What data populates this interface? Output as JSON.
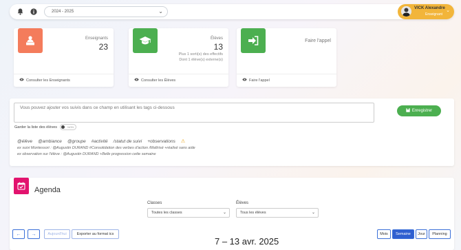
{
  "topbar": {
    "bell_icon": "bell-icon",
    "info_icon": "info-icon",
    "year": "2024 - 2025",
    "user_name": "VICK Alexandre",
    "user_role": "Enseignant"
  },
  "cards": {
    "teachers": {
      "title": "Enseignants",
      "count": "23",
      "link": "Consulter les Enseignants",
      "color": "#f47c5c"
    },
    "students": {
      "title": "Élèves",
      "count": "13",
      "note1": "Plus 1 sorti(s) des effectifs",
      "note2": "Dont 1 élève(s) externe(s)",
      "link": "Consulter les Élèves",
      "color": "#4caf50"
    },
    "call": {
      "title": "Faire l'appel",
      "link": "Faire l'appel",
      "color": "#4caf50"
    }
  },
  "suivi": {
    "placeholder": "Vous pouvez ajouter vos suivis dans ce champ en utilisant les tags ci-dessous",
    "save_label": "Enregistrer",
    "keep_label": "Garder la liste des élèves",
    "toggle_label": "NON",
    "tags": [
      "@élève",
      "@ambiance",
      "@groupe",
      "#activité",
      "/statut de suivi",
      "+observations"
    ],
    "example1": "ex suivi Montessori : @Augustin DURAND #Consolidation des verbes d'action /Maîtrisé +réalisé sans aide",
    "example2": "ex observation sur l'élève : @Augustin DURAND +Belle progression cette semaine"
  },
  "agenda": {
    "title": "Agenda",
    "classes_label": "Classes",
    "classes_value": "Toutes les classes",
    "students_label": "Élèves",
    "students_value": "Tous les élèves",
    "prev": "←",
    "next": "→",
    "today": "Aujourd'hui",
    "export": "Exporter au format ics",
    "date_range": "7 – 13 avr. 2025",
    "views": [
      "Mois",
      "Semaine",
      "Jour",
      "Planning"
    ],
    "active_view": "Semaine"
  }
}
